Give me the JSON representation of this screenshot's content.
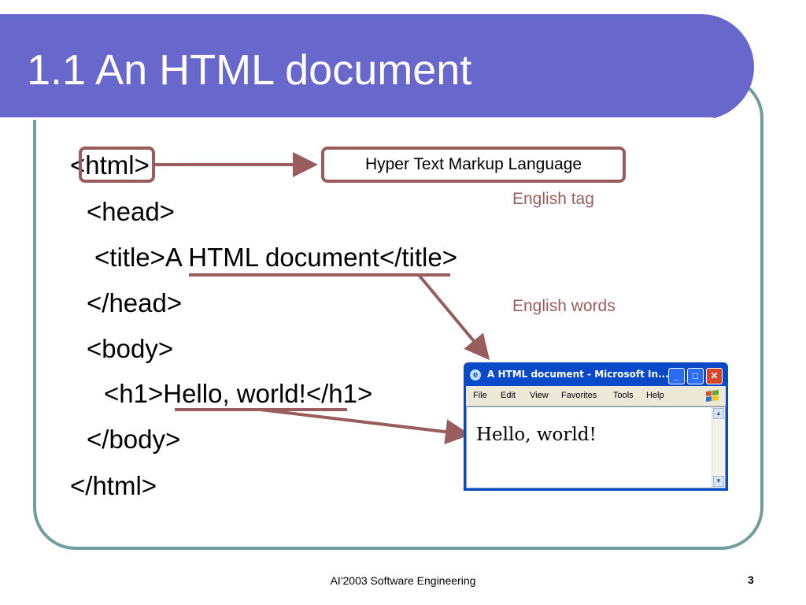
{
  "slide": {
    "title": "1.1 An HTML document",
    "code_lines": [
      "<html>",
      "<head>",
      "<title>A HTML document</title>",
      "</head>",
      "<body>",
      "<h1>Hello, world!</h1>",
      "</body>",
      "</html>"
    ],
    "callout": "Hyper Text Markup Language",
    "note_tag": "English tag",
    "note_words": "English words",
    "footer": "AI'2003 Software Engineering",
    "page_number": "3"
  },
  "browser": {
    "title": "A HTML document - Microsoft In...",
    "menu": [
      "File",
      "Edit",
      "View",
      "Favorites",
      "Tools",
      "Help"
    ],
    "content": "Hello, world!",
    "buttons": {
      "minimize": "_",
      "maximize": "□",
      "close": "✕"
    }
  },
  "colors": {
    "title_bar": "#6767cc",
    "frame": "#6f9e9c",
    "accent": "#9a5d5d",
    "window_blue": "#0a49c8"
  },
  "icons": [
    "ie-icon",
    "windows-flag-icon",
    "scroll-up-icon",
    "scroll-down-icon"
  ]
}
